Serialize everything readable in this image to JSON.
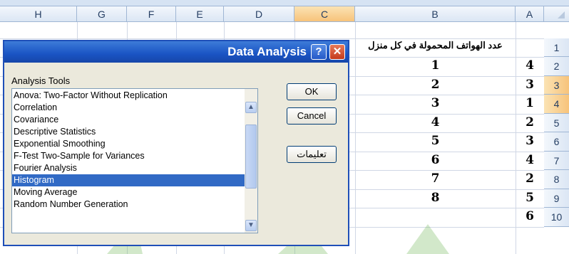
{
  "columns": [
    "H",
    "G",
    "F",
    "E",
    "D",
    "C",
    "B",
    "A"
  ],
  "rows": [
    "1",
    "2",
    "3",
    "4",
    "5",
    "6",
    "7",
    "8",
    "9",
    "10"
  ],
  "selected_column": "C",
  "selected_rows": [
    "3",
    "4"
  ],
  "cells": {
    "B1": "عدد الهواتف المحمولة في كل منزل",
    "B": [
      "1",
      "2",
      "3",
      "4",
      "5",
      "6",
      "7",
      "8"
    ],
    "A": [
      "4",
      "3",
      "1",
      "2",
      "3",
      "4",
      "2",
      "5",
      "6"
    ]
  },
  "dialog": {
    "title": "Data Analysis",
    "help_icon_text": "?",
    "close_icon_text": "✕",
    "tools_label": "Analysis Tools",
    "items": [
      "Anova: Two-Factor Without Replication",
      "Correlation",
      "Covariance",
      "Descriptive Statistics",
      "Exponential Smoothing",
      "F-Test Two-Sample for Variances",
      "Fourier Analysis",
      "Histogram",
      "Moving Average",
      "Random Number Generation"
    ],
    "selected_item": "Histogram",
    "buttons": {
      "ok": "OK",
      "cancel": "Cancel",
      "help": "تعليمات"
    },
    "scroll_up": "▲",
    "scroll_down": "▼"
  },
  "colors": {
    "accent": "#1f4fb8",
    "selection": "#316ac5",
    "header_selected": "#f7c37a"
  }
}
